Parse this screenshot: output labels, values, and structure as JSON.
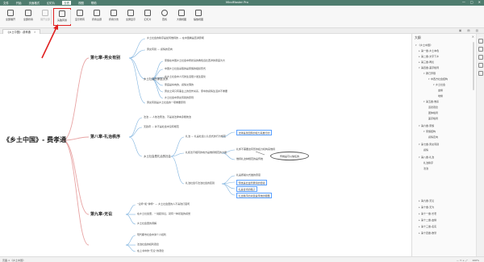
{
  "titlebar": {
    "menu": [
      "文件",
      "开始",
      "页面格式",
      "幻灯片",
      "查看",
      "视图",
      "帮助"
    ],
    "active_menu_index": 4,
    "app_title": "MindMaster Pro",
    "controls": [
      "—",
      "□",
      "✕"
    ]
  },
  "ribbon": {
    "tools": [
      {
        "label": "全部展开",
        "icon": "expand-all-icon"
      },
      {
        "label": "全部折叠",
        "icon": "collapse-all-icon"
      },
      {
        "label": "展开全部",
        "icon": "expand-icon",
        "dim": true
      },
      {
        "label": "头脑风暴",
        "icon": "brainstorm-icon",
        "highlight": true
      },
      {
        "label": "显示所有",
        "icon": "show-all-icon"
      },
      {
        "label": "折叠主题",
        "icon": "fold-topic-icon"
      },
      {
        "label": "折叠分支",
        "icon": "fold-branch-icon"
      },
      {
        "label": "全屏显示",
        "icon": "fullscreen-icon"
      },
      {
        "label": "幻灯片",
        "icon": "slideshow-icon"
      },
      {
        "label": "查找",
        "icon": "search-icon"
      },
      {
        "label": "大纲视图",
        "icon": "outline-view-icon"
      },
      {
        "label": "缩放视图",
        "icon": "zoom-view-icon"
      }
    ]
  },
  "tab": {
    "label": "《乡土中国》-费孝通",
    "close": "✕",
    "tools": "▣ ▤ ▥"
  },
  "mindmap": {
    "root": "《乡土中国》- 费孝通",
    "chapters": [
      "第七章-男女有别",
      "第八章-礼治秩序",
      "第九章-无讼"
    ],
    "ch7": {
      "top_leaf": "乡土社会的秩序是如何维持的 — 在中国看是否满意呢",
      "leaves": [
        "男女有别 — 感情的定向",
        "乡土社会的家庭关系",
        "家族在中国乡土社会中所扮演的角色远比西洋的家庭为大",
        "中国乡土社会采取的是家族的组织形式",
        "在乡土社会中人们的生活很少发生变化",
        "家庭是纵向的，感情淡薄的",
        "男女之间只有事业上的合作关系，家中的感情生活并不重要",
        "乡土社会中男女有别的原则",
        "男女各自在同性中找感情上的满足",
        "在乡土社会中，男女之间保持着距离，避免产生私情"
      ],
      "bottom": "男女有别是乡土社会的一项重要原则"
    },
    "ch8": {
      "leaves": [
        "法治 — 人依法而治，不是说法律本身能统治",
        "无政府 — 并不是社会中没有规范",
        "礼治 — 礼是社会公认合式的行为规范",
        "乡土社会是礼治的社会",
        "礼和法不相同的地方是维持规范的力量",
        "法律是靠国家的权力来推行的",
        "礼却不需要这有形的权力机构来维持",
        "维持礼这种规范的是传统",
        "礼治社会与法治社会的区别",
        "礼并不是靠一个外在的权力来推行的",
        "在乡土社会里，传统的效力更大",
        "传统是社会所累积的经验",
        "文化是依赖象征体系和个人的记忆而维持着的社会共同经验",
        "礼是按着仪式做的意思",
        "礼是合式的路子",
        "礼治秩序的关键是传统的服膺"
      ],
      "callout": "传统是可以信任的"
    },
    "ch9": {
      "leaves": [
        "“讼师”和“律师” — 乡土社会里的人不喜欢打官司",
        "在乡土社会里，一说起诉讼，就有一种羞耻的感觉",
        "乡土社会里的调解",
        "调解是一种教育过程",
        "现代都市社会中讲个人权利",
        "法治社会的权利观念",
        "乡土社会中维持秩序的是礼",
        "社会评价",
        "在上书中的“无讼”的观念"
      ]
    }
  },
  "outline": {
    "title": "大纲",
    "close": "✕",
    "items": [
      "《乡土中国》",
      "第一章-乡土本色",
      "第二章-文字下乡",
      "第三章-再论",
      "第四章-差序格局",
      "群己界限",
      "中西方社会结构",
      "乡土社会",
      "血缘",
      "地缘",
      "第五章-维系",
      "道德观念",
      "团体格局",
      "差序格局",
      "第六章-家族",
      "家族结构",
      "感情定向",
      "第七章-男女有别",
      "感情",
      "第八章-礼治",
      "礼治秩序",
      "法治",
      "第九章-无讼",
      "第十章-无为",
      "第十一章-长老",
      "第十二章-血缘",
      "第十三章-名实",
      "第十四章-欲望"
    ]
  },
  "statusbar": {
    "left": "页面-1  《乡土中国》",
    "zoom": "100%",
    "zoom_controls": "—  ▭  +  ⤢"
  }
}
